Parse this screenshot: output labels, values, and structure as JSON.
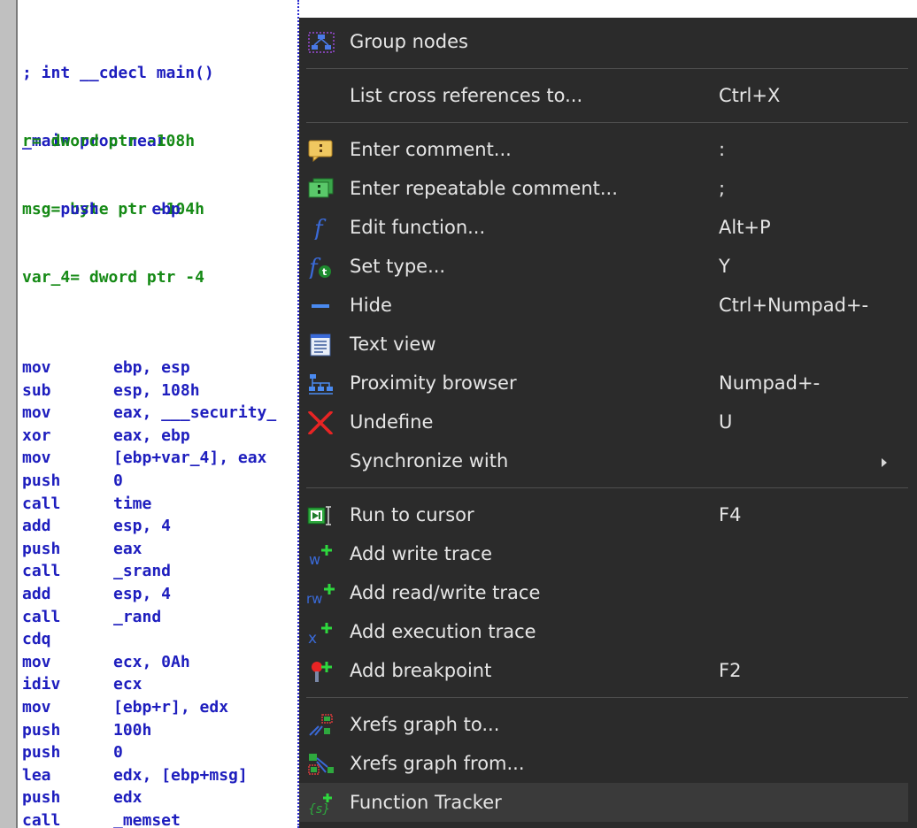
{
  "disasm": {
    "header_lines": [
      "; int __cdecl main()",
      "_main proc near"
    ],
    "vars": [
      {
        "name": "r",
        "text": "= dword ptr -108h"
      },
      {
        "name": "msg",
        "text": "= byte ptr -104h"
      },
      {
        "name": "var_4",
        "text": "= dword ptr -4"
      }
    ],
    "first_instr": {
      "mnemonic": "push",
      "operands": "ebp"
    },
    "instructions": [
      {
        "mnemonic": "mov",
        "operands": "ebp, esp"
      },
      {
        "mnemonic": "sub",
        "operands": "esp, 108h"
      },
      {
        "mnemonic": "mov",
        "operands": "eax, ___security_"
      },
      {
        "mnemonic": "xor",
        "operands": "eax, ebp"
      },
      {
        "mnemonic": "mov",
        "operands": "[ebp+var_4], eax"
      },
      {
        "mnemonic": "push",
        "operands": "0"
      },
      {
        "mnemonic": "call",
        "operands": "time"
      },
      {
        "mnemonic": "add",
        "operands": "esp, 4"
      },
      {
        "mnemonic": "push",
        "operands": "eax"
      },
      {
        "mnemonic": "call",
        "operands": "_srand"
      },
      {
        "mnemonic": "add",
        "operands": "esp, 4"
      },
      {
        "mnemonic": "call",
        "operands": "_rand"
      },
      {
        "mnemonic": "cdq",
        "operands": ""
      },
      {
        "mnemonic": "mov",
        "operands": "ecx, 0Ah"
      },
      {
        "mnemonic": "idiv",
        "operands": "ecx"
      },
      {
        "mnemonic": "mov",
        "operands": "[ebp+r], edx"
      },
      {
        "mnemonic": "push",
        "operands": "100h"
      },
      {
        "mnemonic": "push",
        "operands": "0"
      },
      {
        "mnemonic": "lea",
        "operands": "edx, [ebp+msg]"
      },
      {
        "mnemonic": "push",
        "operands": "edx"
      },
      {
        "mnemonic": "call",
        "operands": "_memset"
      }
    ]
  },
  "menu": {
    "items": [
      {
        "label": "Group nodes",
        "shortcut": "",
        "icon": "group-nodes-icon"
      },
      {
        "label": "List cross references to...",
        "shortcut": "Ctrl+X",
        "icon": ""
      },
      {
        "label": "Enter comment...",
        "shortcut": ":",
        "icon": "comment-icon"
      },
      {
        "label": "Enter repeatable comment...",
        "shortcut": ";",
        "icon": "repeatable-comment-icon"
      },
      {
        "label": "Edit function...",
        "shortcut": "Alt+P",
        "icon": "function-icon"
      },
      {
        "label": "Set type...",
        "shortcut": "Y",
        "icon": "set-type-icon"
      },
      {
        "label": "Hide",
        "shortcut": "Ctrl+Numpad+-",
        "icon": "hide-icon"
      },
      {
        "label": "Text view",
        "shortcut": "",
        "icon": "text-view-icon"
      },
      {
        "label": "Proximity browser",
        "shortcut": "Numpad+-",
        "icon": "proximity-browser-icon"
      },
      {
        "label": "Undefine",
        "shortcut": "U",
        "icon": "undefine-icon"
      },
      {
        "label": "Synchronize with",
        "shortcut": "",
        "icon": ""
      },
      {
        "label": "Run to cursor",
        "shortcut": "F4",
        "icon": "run-to-cursor-icon"
      },
      {
        "label": "Add write trace",
        "shortcut": "",
        "icon": "write-trace-icon"
      },
      {
        "label": "Add read/write trace",
        "shortcut": "",
        "icon": "read-write-trace-icon"
      },
      {
        "label": "Add execution trace",
        "shortcut": "",
        "icon": "execution-trace-icon"
      },
      {
        "label": "Add breakpoint",
        "shortcut": "F2",
        "icon": "breakpoint-icon"
      },
      {
        "label": "Xrefs graph to...",
        "shortcut": "",
        "icon": "xrefs-graph-to-icon"
      },
      {
        "label": "Xrefs graph from...",
        "shortcut": "",
        "icon": "xrefs-graph-from-icon"
      },
      {
        "label": "Function Tracker",
        "shortcut": "",
        "icon": "function-tracker-icon"
      }
    ]
  },
  "colors": {
    "menu_bg": "#2b2b2b",
    "menu_text": "#e6e6e6",
    "asm_blue": "#1e1ebe",
    "asm_green": "#168a16",
    "highlight": "#3a3a3a"
  }
}
